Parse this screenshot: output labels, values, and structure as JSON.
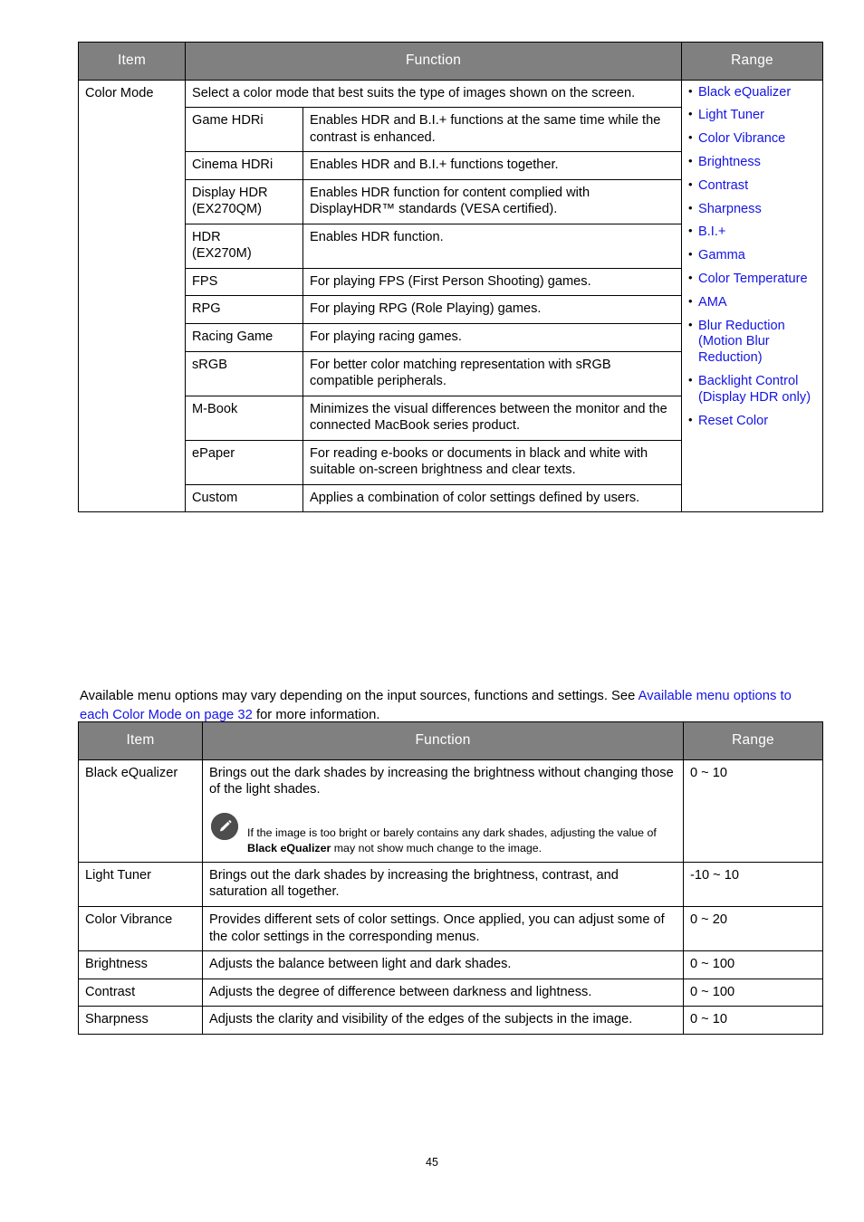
{
  "document": {
    "page_number": "45"
  },
  "colors": {
    "header_bg": "#808080",
    "link": "#1414e6",
    "note_icon_bg": "#4d4d4d"
  },
  "table_color_mode": {
    "headers": {
      "item": "Item",
      "function": "Function",
      "range": "Range"
    },
    "item": "Color Mode",
    "intro": "Select a color mode that best suits the type of images shown on the screen.",
    "rows": [
      {
        "name": "Game HDRi",
        "note": "",
        "description": "Enables HDR and B.I.+ functions at the same time while the contrast is enhanced."
      },
      {
        "name": "Cinema HDRi",
        "note": "",
        "description": "Enables HDR and B.I.+ functions together."
      },
      {
        "name": "Display HDR",
        "note": "(EX270QM)",
        "description": "Enables HDR function for content complied with DisplayHDR™ standards (VESA certified)."
      },
      {
        "name": "HDR",
        "note": "(EX270M)",
        "description": "Enables HDR function."
      },
      {
        "name": "FPS",
        "note": "",
        "description": "For playing FPS (First Person Shooting) games."
      },
      {
        "name": "RPG",
        "note": "",
        "description": "For playing RPG (Role Playing) games."
      },
      {
        "name": "Racing Game",
        "note": "",
        "description": "For playing racing games."
      },
      {
        "name": "sRGB",
        "note": "",
        "description": "For better color matching representation with sRGB compatible peripherals."
      },
      {
        "name": "M-Book",
        "note": "",
        "description": "Minimizes the visual differences between the monitor and the connected MacBook series product."
      },
      {
        "name": "ePaper",
        "note": "",
        "description": "For reading e-books or documents in black and white with suitable on-screen brightness and clear texts."
      },
      {
        "name": "Custom",
        "note": "",
        "description": "Applies a combination of color settings defined by users."
      }
    ],
    "range_items": [
      "Black eQualizer",
      "Light Tuner",
      "Color Vibrance",
      "Brightness",
      "Contrast",
      "Sharpness",
      "B.I.+",
      "Gamma",
      "Color Temperature",
      "AMA",
      "Blur Reduction (Motion Blur Reduction)",
      "Backlight Control (Display HDR only)",
      "Reset Color"
    ]
  },
  "available_note": {
    "text_before": "Available menu options may vary depending on the input sources, functions and settings. See ",
    "link_text": "Available menu options to each Color Mode on page 32",
    "text_after": " for more information."
  },
  "table_settings": {
    "headers": {
      "item": "Item",
      "function": "Function",
      "range": "Range"
    },
    "rows": [
      {
        "item": "Black eQualizer",
        "function": "Brings out the dark shades by increasing the brightness without changing those of the light shades.",
        "range": "0 ~ 10",
        "note": {
          "icon": "pencil-icon",
          "text_before": "If the image is too bright or barely contains any dark shades, adjusting the value of ",
          "bold_text": "Black eQualizer",
          "text_after": " may not show much change to the image."
        }
      },
      {
        "item": "Light Tuner",
        "function": "Brings out the dark shades by increasing the brightness, contrast, and saturation all together.",
        "range": "-10 ~ 10"
      },
      {
        "item": "Color Vibrance",
        "function": "Provides different sets of color settings. Once applied, you can adjust some of the color settings in the corresponding menus.",
        "range": "0 ~ 20"
      },
      {
        "item": "Brightness",
        "function": "Adjusts the balance between light and dark shades.",
        "range": "0 ~ 100"
      },
      {
        "item": "Contrast",
        "function": "Adjusts the degree of difference between darkness and lightness.",
        "range": "0 ~ 100"
      },
      {
        "item": "Sharpness",
        "function": "Adjusts the clarity and visibility of the edges of the subjects in the image.",
        "range": "0 ~ 10"
      }
    ]
  }
}
